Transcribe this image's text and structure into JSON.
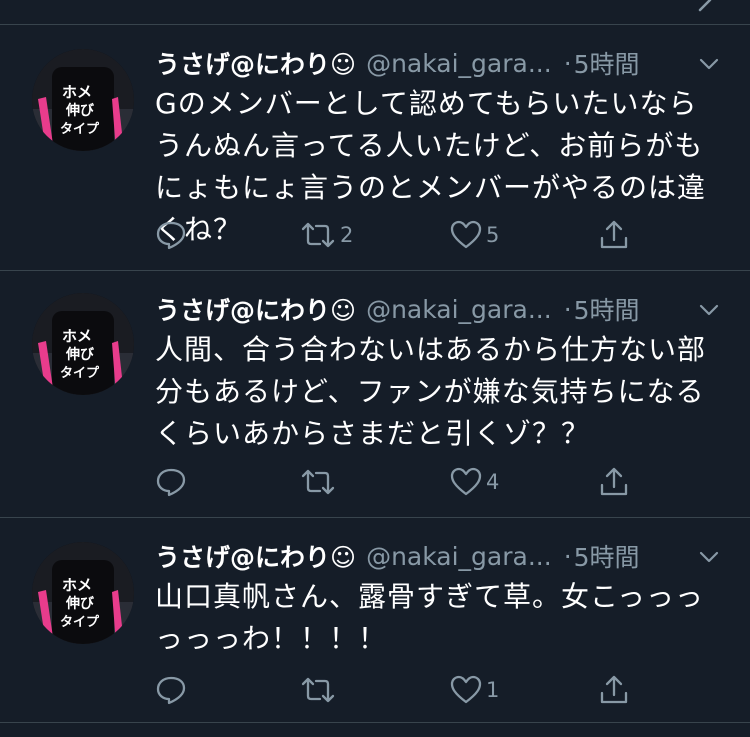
{
  "tweets": [
    {
      "name": "うさげ@にわり☺",
      "handle": "@nakai_gara...",
      "separator": "·",
      "time": "5時間",
      "text": "Gのメンバーとして認めてもらいたいならうんぬん言ってる人いたけど、お前らがもにょもにょ言うのとメンバーがやるのは違くね？",
      "replies": "",
      "retweets": "2",
      "likes": "5"
    },
    {
      "name": "うさげ@にわり☺",
      "handle": "@nakai_gara...",
      "separator": "·",
      "time": "5時間",
      "text": "人間、合う合わないはあるから仕方ない部分もあるけど、ファンが嫌な気持ちになるくらいあからさまだと引くゾ？？",
      "replies": "",
      "retweets": "",
      "likes": "4"
    },
    {
      "name": "うさげ@にわり☺",
      "handle": "@nakai_gara...",
      "separator": "·",
      "time": "5時間",
      "text": "山口真帆さん、露骨すぎて草。女こっっっっっっわ！！！！",
      "replies": "",
      "retweets": "",
      "likes": "1"
    }
  ],
  "colors": {
    "background": "#151d28",
    "divider": "#38444d",
    "secondary_text": "#8899a6",
    "primary_text": "#ffffff",
    "avatar_accent": "#e83c8c"
  },
  "icons": {
    "reply": "reply-icon",
    "retweet": "retweet-icon",
    "like": "heart-icon",
    "share": "share-icon",
    "menu": "chevron-down-icon"
  }
}
